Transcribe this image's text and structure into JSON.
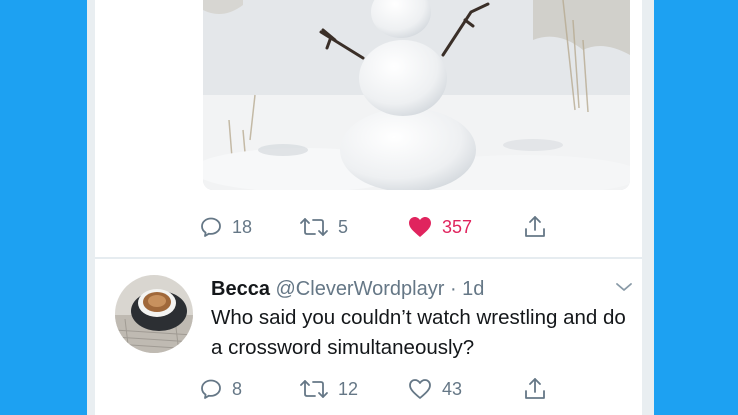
{
  "tweet1": {
    "actions": {
      "reply_count": "18",
      "retweet_count": "5",
      "like_count": "357"
    }
  },
  "tweet2": {
    "name": "Becca",
    "handle": "@CleverWordplayr",
    "separator": "·",
    "time": "1d",
    "text": "Who said you couldn’t watch wrestling and do a crossword simultaneously?",
    "actions": {
      "reply_count": "8",
      "retweet_count": "12",
      "like_count": "43"
    }
  },
  "colors": {
    "brand_blue": "#1da1f2",
    "like_red": "#e0245e",
    "muted_gray": "#657786"
  },
  "icons": [
    "reply-icon",
    "retweet-icon",
    "heart-icon",
    "share-icon",
    "chevron-down-icon"
  ]
}
